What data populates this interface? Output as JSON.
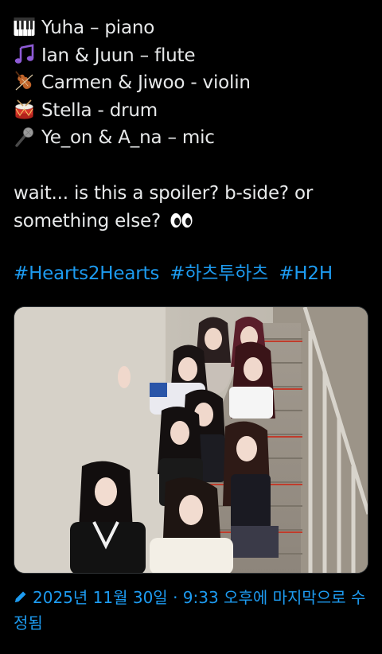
{
  "tweet": {
    "lines": [
      {
        "icon": "piano-keys-icon",
        "text": "Yuha – piano"
      },
      {
        "icon": "music-notes-icon",
        "text": "Ian & Juun – flute"
      },
      {
        "icon": "violin-icon",
        "text": "Carmen & Jiwoo - violin"
      },
      {
        "icon": "drum-icon",
        "text": "Stella - drum"
      },
      {
        "icon": "microphone-icon",
        "text": "Ye_on & A_na – mic"
      }
    ],
    "question": "wait... is this a spoiler? b-side? or something else?",
    "question_emoji": "eyes-icon",
    "hashtags": [
      "#Hearts2Hearts",
      "#하츠투하츠",
      "#H2H"
    ],
    "photo_alt": "Group photo of eight members posing on a staircase",
    "edited_text": "2025년 11월 30일 · 9:33 오후에 마지막으로 수정됨"
  },
  "colors": {
    "background": "#000000",
    "text": "#e7e9ea",
    "link": "#1d9bf0"
  }
}
